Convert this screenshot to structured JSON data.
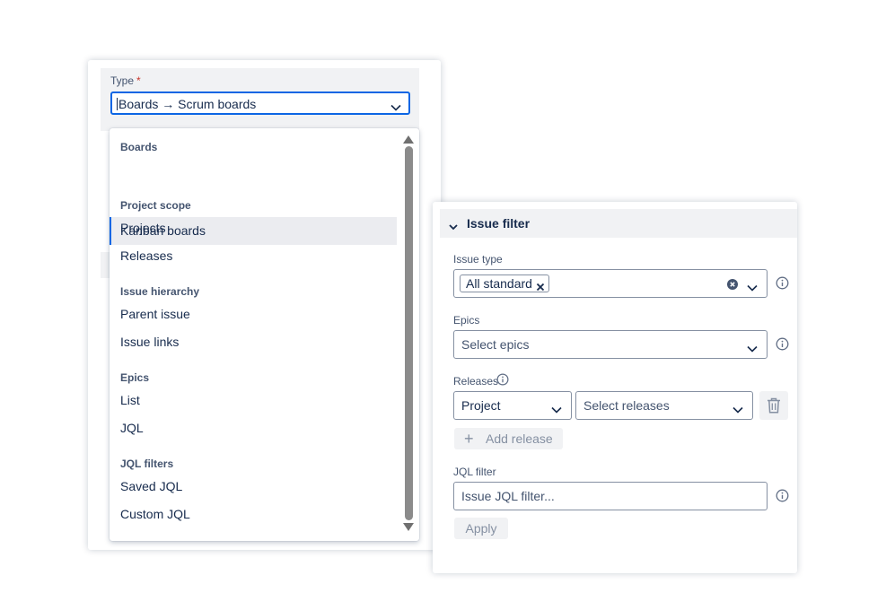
{
  "type_field": {
    "label": "Type",
    "required_marker": "*",
    "value": "Boards → Scrum boards"
  },
  "dropdown": {
    "groups": [
      {
        "label": "Boards",
        "items": [
          {
            "label": "Kanban boards",
            "selected": true
          }
        ]
      },
      {
        "label": "Project scope",
        "items": [
          {
            "label": "Projects"
          },
          {
            "label": "Releases"
          }
        ]
      },
      {
        "label": "Issue hierarchy",
        "items": [
          {
            "label": "Parent issue"
          },
          {
            "label": "Issue links"
          }
        ]
      },
      {
        "label": "Epics",
        "items": [
          {
            "label": "List"
          },
          {
            "label": "JQL"
          }
        ]
      },
      {
        "label": "JQL filters",
        "items": [
          {
            "label": "Saved JQL"
          },
          {
            "label": "Custom JQL"
          }
        ]
      }
    ]
  },
  "issue_filter": {
    "title": "Issue filter",
    "issue_type": {
      "label": "Issue type",
      "chip": "All standard"
    },
    "epics": {
      "label": "Epics",
      "placeholder": "Select epics"
    },
    "releases": {
      "label": "Releases",
      "scope_value": "Project",
      "placeholder": "Select releases",
      "add_label": "Add release"
    },
    "jql_filter": {
      "label": "JQL filter",
      "placeholder": "Issue JQL filter..."
    },
    "apply_label": "Apply"
  },
  "colors": {
    "accent": "#0c66e4",
    "subtle_bg": "#f1f2f4",
    "text": "#172b4d",
    "muted": "#44546f",
    "required": "#c9372c"
  }
}
